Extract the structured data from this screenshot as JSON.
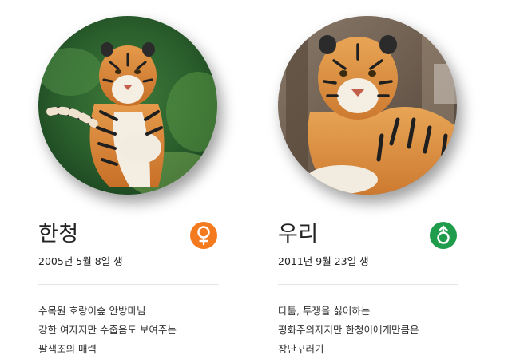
{
  "colors": {
    "female_badge": "#f47a20",
    "male_badge": "#1f9c4c"
  },
  "tigers": [
    {
      "name": "한청",
      "gender": "♀",
      "gender_icon": "female-symbol-icon",
      "birth": "2005년 5월 8일 생",
      "description": [
        "수목원 호랑이숲 안방마님",
        "강한 여자지만 수줍음도 보여주는",
        "팔색조의 매력"
      ]
    },
    {
      "name": "우리",
      "gender": "♂",
      "gender_icon": "male-symbol-icon",
      "birth": "2011년 9월 23일 생",
      "description": [
        "다툼, 투쟁을 싫어하는",
        "평화주의자지만 한청이에게만큼은",
        "장난꾸러기"
      ]
    }
  ]
}
